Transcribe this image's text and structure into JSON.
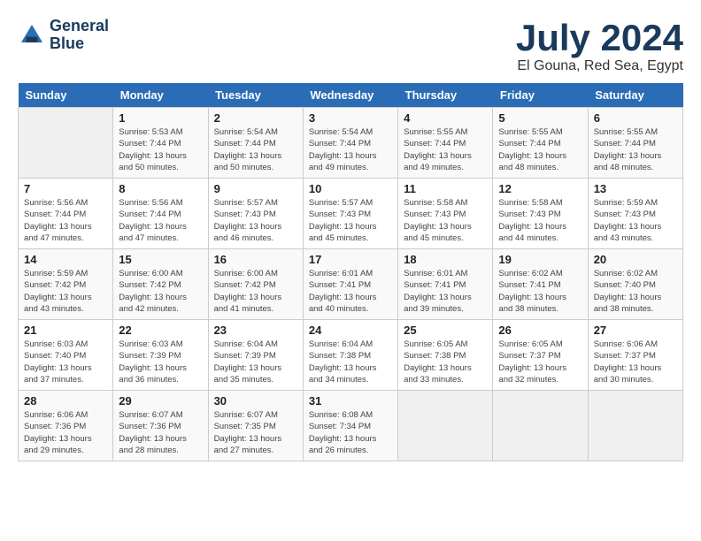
{
  "header": {
    "logo_line1": "General",
    "logo_line2": "Blue",
    "month": "July 2024",
    "location": "El Gouna, Red Sea, Egypt"
  },
  "weekdays": [
    "Sunday",
    "Monday",
    "Tuesday",
    "Wednesday",
    "Thursday",
    "Friday",
    "Saturday"
  ],
  "weeks": [
    [
      {
        "day": "",
        "info": ""
      },
      {
        "day": "1",
        "info": "Sunrise: 5:53 AM\nSunset: 7:44 PM\nDaylight: 13 hours\nand 50 minutes."
      },
      {
        "day": "2",
        "info": "Sunrise: 5:54 AM\nSunset: 7:44 PM\nDaylight: 13 hours\nand 50 minutes."
      },
      {
        "day": "3",
        "info": "Sunrise: 5:54 AM\nSunset: 7:44 PM\nDaylight: 13 hours\nand 49 minutes."
      },
      {
        "day": "4",
        "info": "Sunrise: 5:55 AM\nSunset: 7:44 PM\nDaylight: 13 hours\nand 49 minutes."
      },
      {
        "day": "5",
        "info": "Sunrise: 5:55 AM\nSunset: 7:44 PM\nDaylight: 13 hours\nand 48 minutes."
      },
      {
        "day": "6",
        "info": "Sunrise: 5:55 AM\nSunset: 7:44 PM\nDaylight: 13 hours\nand 48 minutes."
      }
    ],
    [
      {
        "day": "7",
        "info": "Sunrise: 5:56 AM\nSunset: 7:44 PM\nDaylight: 13 hours\nand 47 minutes."
      },
      {
        "day": "8",
        "info": "Sunrise: 5:56 AM\nSunset: 7:44 PM\nDaylight: 13 hours\nand 47 minutes."
      },
      {
        "day": "9",
        "info": "Sunrise: 5:57 AM\nSunset: 7:43 PM\nDaylight: 13 hours\nand 46 minutes."
      },
      {
        "day": "10",
        "info": "Sunrise: 5:57 AM\nSunset: 7:43 PM\nDaylight: 13 hours\nand 45 minutes."
      },
      {
        "day": "11",
        "info": "Sunrise: 5:58 AM\nSunset: 7:43 PM\nDaylight: 13 hours\nand 45 minutes."
      },
      {
        "day": "12",
        "info": "Sunrise: 5:58 AM\nSunset: 7:43 PM\nDaylight: 13 hours\nand 44 minutes."
      },
      {
        "day": "13",
        "info": "Sunrise: 5:59 AM\nSunset: 7:43 PM\nDaylight: 13 hours\nand 43 minutes."
      }
    ],
    [
      {
        "day": "14",
        "info": "Sunrise: 5:59 AM\nSunset: 7:42 PM\nDaylight: 13 hours\nand 43 minutes."
      },
      {
        "day": "15",
        "info": "Sunrise: 6:00 AM\nSunset: 7:42 PM\nDaylight: 13 hours\nand 42 minutes."
      },
      {
        "day": "16",
        "info": "Sunrise: 6:00 AM\nSunset: 7:42 PM\nDaylight: 13 hours\nand 41 minutes."
      },
      {
        "day": "17",
        "info": "Sunrise: 6:01 AM\nSunset: 7:41 PM\nDaylight: 13 hours\nand 40 minutes."
      },
      {
        "day": "18",
        "info": "Sunrise: 6:01 AM\nSunset: 7:41 PM\nDaylight: 13 hours\nand 39 minutes."
      },
      {
        "day": "19",
        "info": "Sunrise: 6:02 AM\nSunset: 7:41 PM\nDaylight: 13 hours\nand 38 minutes."
      },
      {
        "day": "20",
        "info": "Sunrise: 6:02 AM\nSunset: 7:40 PM\nDaylight: 13 hours\nand 38 minutes."
      }
    ],
    [
      {
        "day": "21",
        "info": "Sunrise: 6:03 AM\nSunset: 7:40 PM\nDaylight: 13 hours\nand 37 minutes."
      },
      {
        "day": "22",
        "info": "Sunrise: 6:03 AM\nSunset: 7:39 PM\nDaylight: 13 hours\nand 36 minutes."
      },
      {
        "day": "23",
        "info": "Sunrise: 6:04 AM\nSunset: 7:39 PM\nDaylight: 13 hours\nand 35 minutes."
      },
      {
        "day": "24",
        "info": "Sunrise: 6:04 AM\nSunset: 7:38 PM\nDaylight: 13 hours\nand 34 minutes."
      },
      {
        "day": "25",
        "info": "Sunrise: 6:05 AM\nSunset: 7:38 PM\nDaylight: 13 hours\nand 33 minutes."
      },
      {
        "day": "26",
        "info": "Sunrise: 6:05 AM\nSunset: 7:37 PM\nDaylight: 13 hours\nand 32 minutes."
      },
      {
        "day": "27",
        "info": "Sunrise: 6:06 AM\nSunset: 7:37 PM\nDaylight: 13 hours\nand 30 minutes."
      }
    ],
    [
      {
        "day": "28",
        "info": "Sunrise: 6:06 AM\nSunset: 7:36 PM\nDaylight: 13 hours\nand 29 minutes."
      },
      {
        "day": "29",
        "info": "Sunrise: 6:07 AM\nSunset: 7:36 PM\nDaylight: 13 hours\nand 28 minutes."
      },
      {
        "day": "30",
        "info": "Sunrise: 6:07 AM\nSunset: 7:35 PM\nDaylight: 13 hours\nand 27 minutes."
      },
      {
        "day": "31",
        "info": "Sunrise: 6:08 AM\nSunset: 7:34 PM\nDaylight: 13 hours\nand 26 minutes."
      },
      {
        "day": "",
        "info": ""
      },
      {
        "day": "",
        "info": ""
      },
      {
        "day": "",
        "info": ""
      }
    ]
  ]
}
